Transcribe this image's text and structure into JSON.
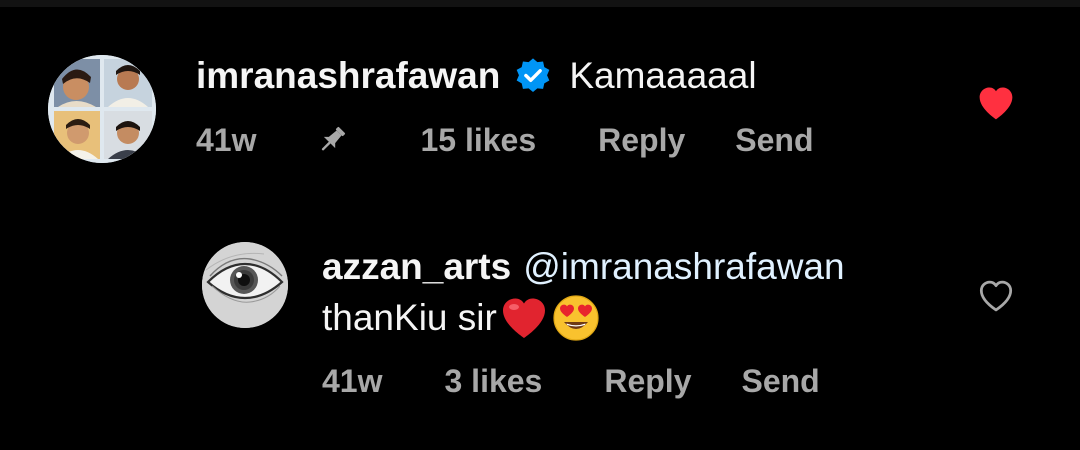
{
  "comment": {
    "username": "imranashrafawan",
    "verified": true,
    "text": "Kamaaaaal",
    "time": "41w",
    "pinned": true,
    "likes": "15 likes",
    "reply_label": "Reply",
    "send_label": "Send",
    "liked": true
  },
  "reply": {
    "username": "azzan_arts",
    "mention": "@imranashrafawan",
    "text": "thanKiu sir",
    "time": "41w",
    "likes": "3 likes",
    "reply_label": "Reply",
    "send_label": "Send",
    "liked": false
  },
  "colors": {
    "background": "#000000",
    "primary_text": "#f5f5f5",
    "secondary_text": "#a8a8a8",
    "mention": "#e0f1ff",
    "liked_heart": "#ff3040",
    "verified_badge": "#0095f6"
  },
  "icons": {
    "verified": "verified-badge-icon",
    "pin": "pin-icon",
    "liked": "heart-filled-icon",
    "unliked": "heart-outline-icon",
    "emoji_1": "red-heart-emoji",
    "emoji_2": "heart-eyes-emoji"
  }
}
